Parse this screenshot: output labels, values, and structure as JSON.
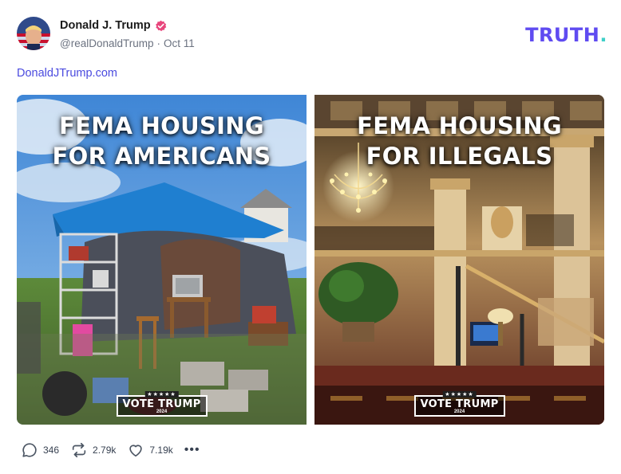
{
  "post": {
    "author": {
      "display_name": "Donald J. Trump",
      "handle": "@realDonaldTrump",
      "separator": "·",
      "date": "Oct 11",
      "verified": true,
      "verified_color": "#e8467c"
    },
    "brand": {
      "text": "TRUTH",
      "dot": ".",
      "color": "#5f4bf1",
      "dot_color": "#3fd0c8"
    },
    "link_text": "DonaldJTrump.com",
    "images": [
      {
        "headline_lines": [
          "FEMA HOUSING",
          "FOR AMERICANS"
        ],
        "badge": {
          "stars": "★★★★★",
          "text": "VOTE TRUMP",
          "year": "2024"
        }
      },
      {
        "headline_lines": [
          "FEMA HOUSING",
          "FOR ILLEGALS"
        ],
        "badge": {
          "stars": "★★★★★",
          "text": "VOTE TRUMP",
          "year": "2024"
        }
      }
    ],
    "actions": {
      "replies": "346",
      "retruths": "2.79k",
      "likes": "7.19k",
      "more": "•••"
    }
  }
}
